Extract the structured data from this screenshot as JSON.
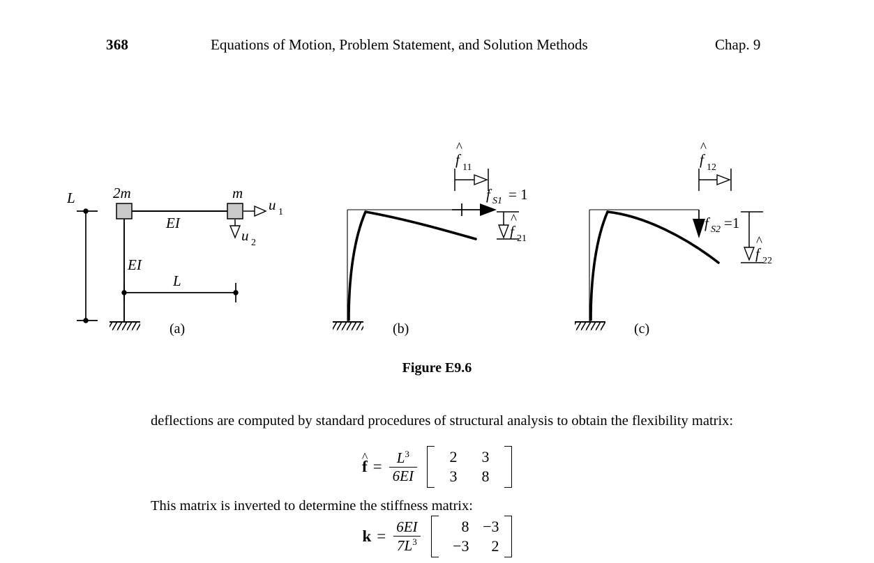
{
  "running_head": {
    "page_number": "368",
    "title": "Equations of Motion, Problem Statement, and Solution Methods",
    "chapter": "Chap. 9"
  },
  "figure": {
    "caption": "Figure E9.6",
    "subcaptions": [
      "(a)",
      "(b)",
      "(c)"
    ],
    "panel_a": {
      "mass_left_label": "2m",
      "mass_right_label": "m",
      "beam_stiffness_label": "EI",
      "column_stiffness_label": "EI",
      "vertical_dimension_label": "L",
      "horizontal_dimension_label": "L",
      "dof_horizontal_label": "u",
      "dof_horizontal_sub": "1",
      "dof_vertical_label": "u",
      "dof_vertical_sub": "2"
    },
    "panel_b": {
      "disp_horizontal_symbol": "f",
      "disp_horizontal_sub": "11",
      "force_symbol": "f",
      "force_sub": "S1",
      "force_value": "= 1",
      "disp_vertical_symbol": "f",
      "disp_vertical_sub": "21"
    },
    "panel_c": {
      "disp_horizontal_symbol": "f",
      "disp_horizontal_sub": "12",
      "force_symbol": "f",
      "force_sub": "S2",
      "force_value": "=1",
      "disp_vertical_symbol": "f",
      "disp_vertical_sub": "22"
    }
  },
  "body": {
    "paragraph_1": "deflections are computed by standard procedures of structural analysis to obtain the flexibility matrix:",
    "paragraph_2": "This matrix is inverted to determine the stiffness matrix:"
  },
  "equations": {
    "flexibility": {
      "lhs": "f",
      "lhs_accent": "^",
      "equals": "=",
      "numerator": "L",
      "numerator_exp": "3",
      "denominator": "6EI",
      "matrix": [
        [
          "2",
          "3"
        ],
        [
          "3",
          "8"
        ]
      ]
    },
    "stiffness": {
      "lhs": "k",
      "lhs_accent": "",
      "equals": "=",
      "numerator": "6EI",
      "numerator_exp": "",
      "denominator_base": "7L",
      "denominator_exp": "3",
      "matrix": [
        [
          "8",
          "−3"
        ],
        [
          "−3",
          "2"
        ]
      ]
    }
  },
  "colors": {
    "ink": "#000000",
    "mass_fill": "#c9c9c9",
    "background": "#ffffff"
  }
}
